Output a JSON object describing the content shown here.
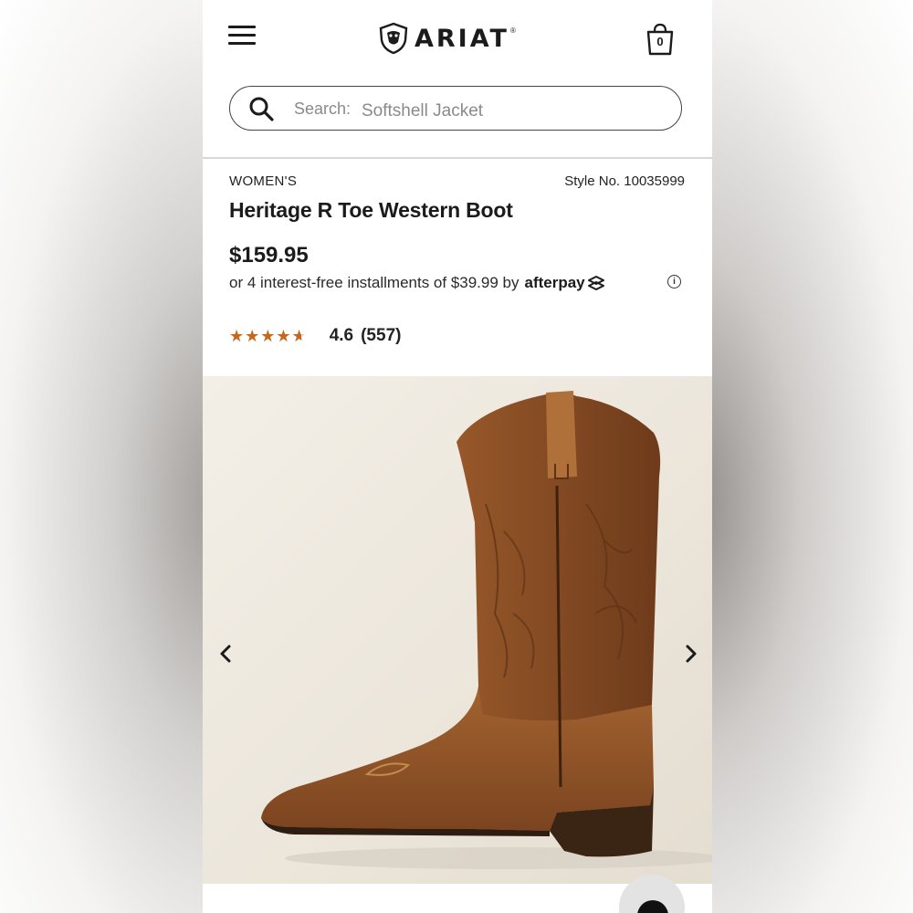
{
  "header": {
    "brand": "ARIAT",
    "brand_mark": "®",
    "cart_count": "0",
    "menu_icon": "hamburger-menu-icon",
    "cart_icon": "shopping-bag-icon",
    "logo_icon": "ariat-shield-logo-icon"
  },
  "search": {
    "label": "Search:",
    "value": "Softshell Jacket",
    "icon": "search-icon"
  },
  "product": {
    "category": "WOMEN'S",
    "style_no": "Style No. 10035999",
    "title": "Heritage R Toe Western Boot",
    "price": "$159.95",
    "installments_text": "or 4 interest-free installments of $39.99 by",
    "afterpay_label": "afterpay",
    "info_icon": "info-icon",
    "rating": {
      "value": "4.6",
      "count": "(557)",
      "stars_fraction": 0.92
    }
  },
  "gallery": {
    "prev_icon": "chevron-left-icon",
    "next_icon": "chevron-right-icon",
    "image": "brown-western-boot-image"
  },
  "colors": {
    "star": "#c8661b",
    "text": "#1b1b1b",
    "boot": "#8a4f24"
  }
}
